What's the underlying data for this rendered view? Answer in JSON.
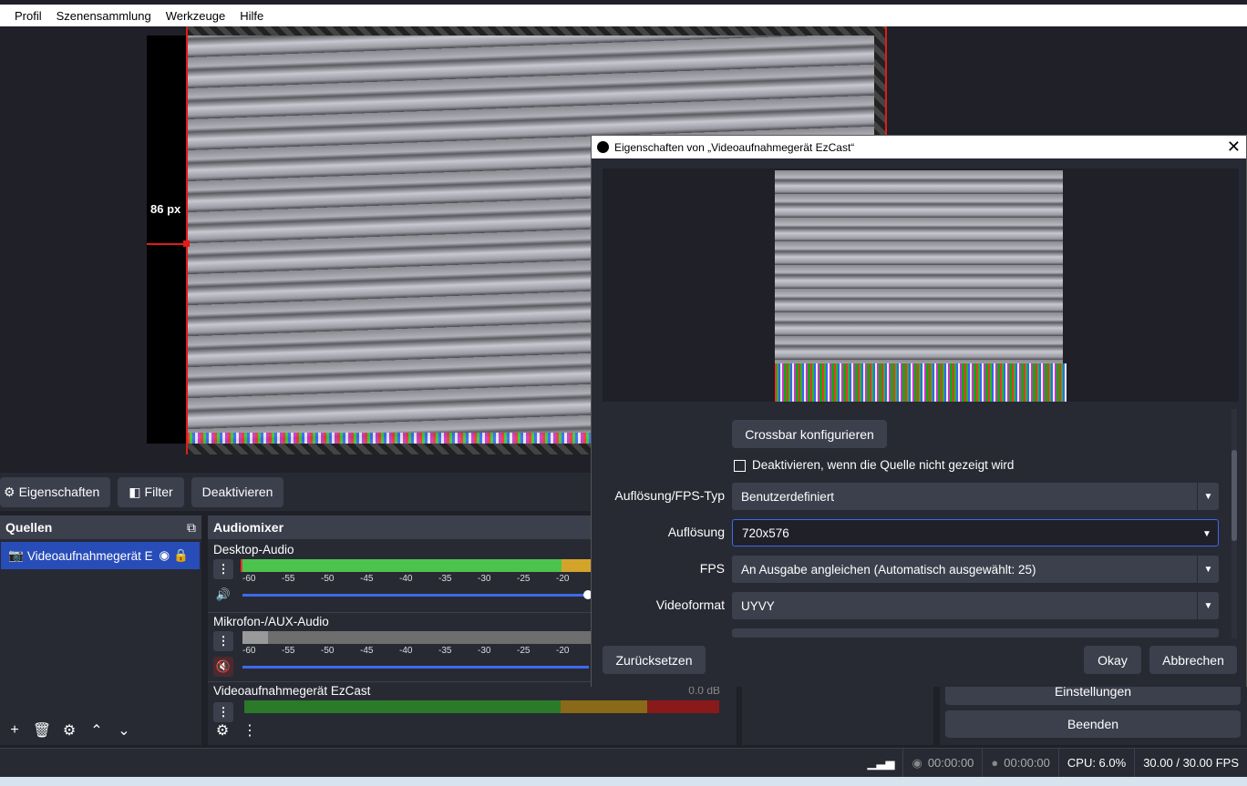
{
  "menu": [
    "Profil",
    "Szenensammlung",
    "Werkzeuge",
    "Hilfe"
  ],
  "preview": {
    "distance_label": "86 px"
  },
  "toolbar": {
    "properties": "Eigenschaften",
    "filters": "Filter",
    "deactivate": "Deaktivieren"
  },
  "sources": {
    "title": "Quellen",
    "items": [
      {
        "label": "Videoaufnahmegerät E"
      }
    ]
  },
  "mixer": {
    "title": "Audiomixer",
    "scale": [
      "-60",
      "-55",
      "-50",
      "-45",
      "-40",
      "-35",
      "-30",
      "-25",
      "-20"
    ],
    "channels": [
      {
        "name": "Desktop-Audio"
      },
      {
        "name": "Mikrofon-/AUX-Audio"
      },
      {
        "name": "Videoaufnahmegerät EzCast",
        "db": "0.0 dB"
      }
    ]
  },
  "controls": {
    "settings": "Einstellungen",
    "exit": "Beenden"
  },
  "status": {
    "rec_time": "00:00:00",
    "stream_time": "00:00:00",
    "cpu": "CPU: 6.0%",
    "fps": "30.00 / 30.00 FPS"
  },
  "dialog": {
    "title": "Eigenschaften von „Videoaufnahmegerät EzCast“",
    "crossbar_button": "Crossbar konfigurieren",
    "deactivate_checkbox": "Deaktivieren, wenn die Quelle nicht gezeigt wird",
    "fields": [
      {
        "label": "Auflösung/FPS-Typ",
        "value": "Benutzerdefiniert"
      },
      {
        "label": "Auflösung",
        "value": "720x576"
      },
      {
        "label": "FPS",
        "value": "An Ausgabe angleichen (Automatisch ausgewählt: 25)"
      },
      {
        "label": "Videoformat",
        "value": "UYVY"
      }
    ],
    "reset": "Zurücksetzen",
    "ok": "Okay",
    "cancel": "Abbrechen"
  }
}
